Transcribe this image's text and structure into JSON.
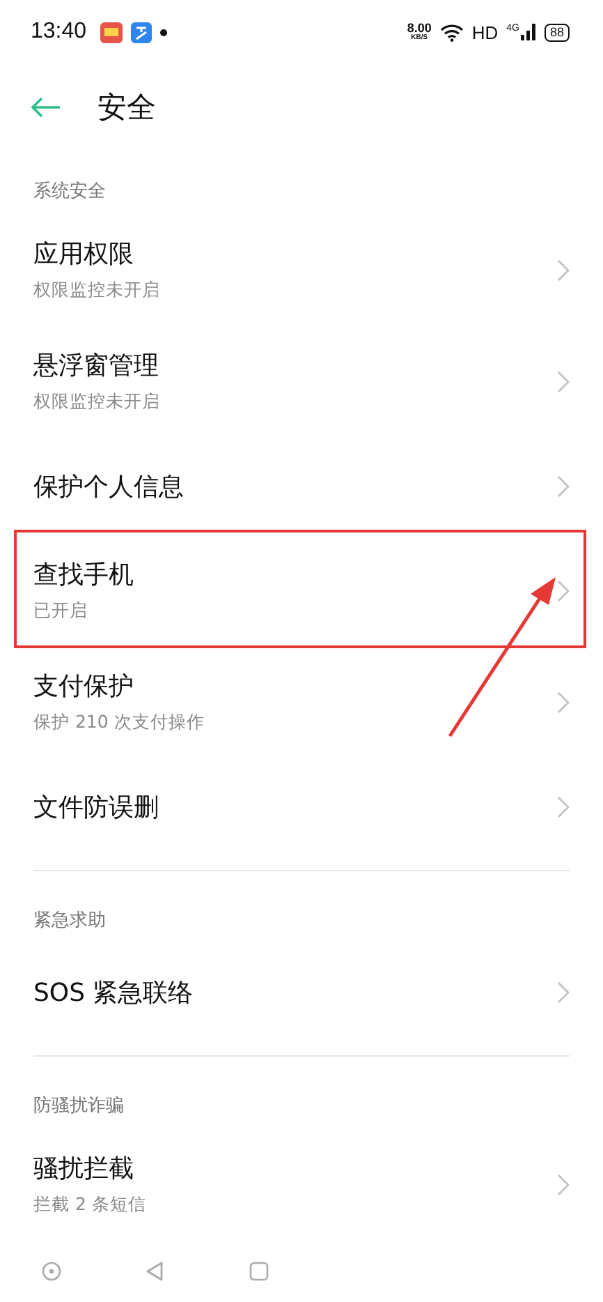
{
  "status_bar": {
    "time": "13:40",
    "speed_value": "8.00",
    "speed_unit": "KB/S",
    "hd": "HD",
    "network": "4G",
    "battery": "88"
  },
  "header": {
    "title": "安全"
  },
  "sections": [
    {
      "label": "系统安全",
      "items": [
        {
          "title": "应用权限",
          "subtitle": "权限监控未开启",
          "highlighted": false
        },
        {
          "title": "悬浮窗管理",
          "subtitle": "权限监控未开启",
          "highlighted": false
        },
        {
          "title": "保护个人信息",
          "highlighted": false
        },
        {
          "title": "查找手机",
          "subtitle": "已开启",
          "highlighted": true
        },
        {
          "title": "支付保护",
          "subtitle": "保护 210 次支付操作",
          "highlighted": false
        },
        {
          "title": "文件防误删",
          "highlighted": false
        }
      ]
    },
    {
      "label": "紧急求助",
      "items": [
        {
          "title": "SOS 紧急联络",
          "highlighted": false
        }
      ]
    },
    {
      "label": "防骚扰诈骗",
      "items": [
        {
          "title": "骚扰拦截",
          "subtitle": "拦截 2 条短信",
          "highlighted": false
        }
      ]
    }
  ]
}
